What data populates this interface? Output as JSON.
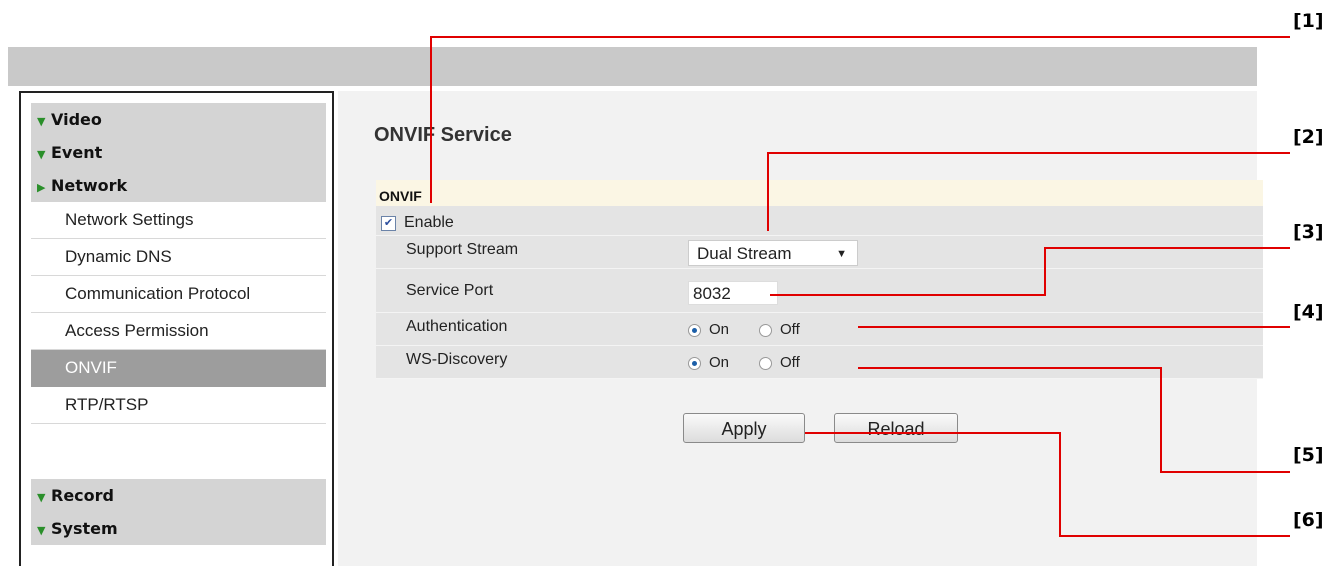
{
  "sidebar": {
    "sections_top": [
      {
        "label": "Video",
        "arrow": "down"
      },
      {
        "label": "Event",
        "arrow": "down"
      },
      {
        "label": "Network",
        "arrow": "right"
      }
    ],
    "network_items": [
      "Network Settings",
      "Dynamic DNS",
      "Communication Protocol",
      "Access Permission",
      "ONVIF",
      "RTP/RTSP"
    ],
    "active_item": "ONVIF",
    "sections_bottom": [
      {
        "label": "Record",
        "arrow": "down"
      },
      {
        "label": "System",
        "arrow": "down"
      }
    ]
  },
  "main": {
    "title": "ONVIF Service",
    "section_header": "ONVIF",
    "enable": {
      "label": "Enable",
      "checked": true
    },
    "support_stream": {
      "label": "Support Stream",
      "value": "Dual Stream"
    },
    "service_port": {
      "label": "Service Port",
      "value": "8032"
    },
    "authentication": {
      "label": "Authentication",
      "on_label": "On",
      "off_label": "Off",
      "selected": "On"
    },
    "ws_discovery": {
      "label": "WS-Discovery",
      "on_label": "On",
      "off_label": "Off",
      "selected": "On"
    },
    "apply_label": "Apply",
    "reload_label": "Reload"
  },
  "callouts": [
    "[1]",
    "[2]",
    "[3]",
    "[4]",
    "[5]",
    "[6]"
  ],
  "colors": {
    "callout_line": "#e00000",
    "active_item_bg": "#9d9d9d",
    "header_bg": "#c9c9c9"
  }
}
